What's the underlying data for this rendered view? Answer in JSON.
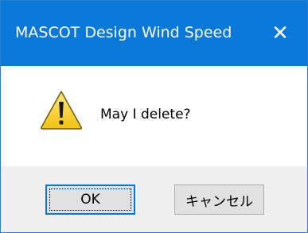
{
  "window": {
    "title": "MASCOT Design Wind Speed",
    "close_glyph": "✕"
  },
  "message": {
    "icon": "warning-icon",
    "text": "May I delete?"
  },
  "buttons": {
    "ok_label": "OK",
    "cancel_label": "キャンセル"
  },
  "colors": {
    "titlebar": "#0a78d7",
    "footer": "#f0f0f0",
    "warning_fill": "#f9d21b",
    "focus_border": "#0078d7"
  }
}
